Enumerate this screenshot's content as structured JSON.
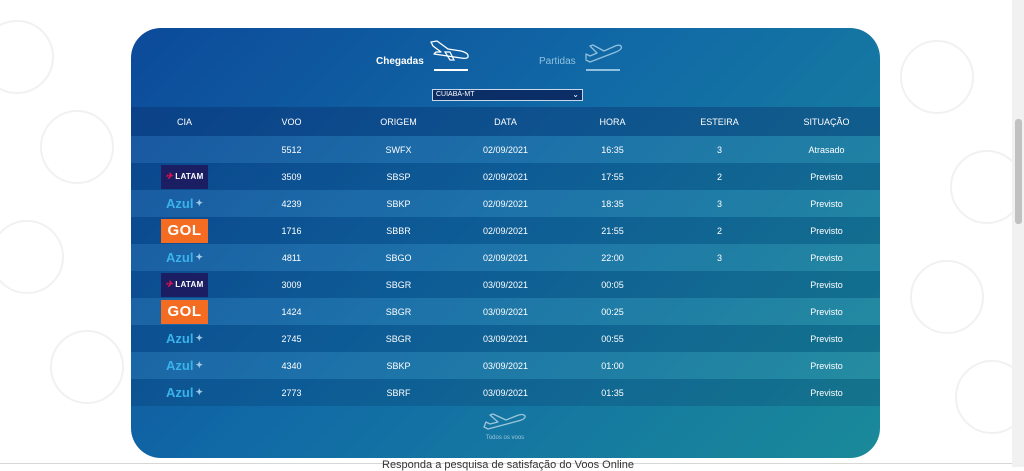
{
  "tabs": {
    "arrivals_label": "Chegadas",
    "departures_label": "Partidas"
  },
  "city_select": {
    "value": "CUIABÁ-MT"
  },
  "table": {
    "headers": [
      "CIA",
      "VOO",
      "ORIGEM",
      "DATA",
      "HORA",
      "ESTEIRA",
      "SITUAÇÃO"
    ],
    "rows": [
      {
        "airline": "",
        "flight": "5512",
        "origin": "SWFX",
        "date": "02/09/2021",
        "time": "16:35",
        "belt": "3",
        "status": "Atrasado"
      },
      {
        "airline": "LATAM",
        "flight": "3509",
        "origin": "SBSP",
        "date": "02/09/2021",
        "time": "17:55",
        "belt": "2",
        "status": "Previsto"
      },
      {
        "airline": "Azul",
        "flight": "4239",
        "origin": "SBKP",
        "date": "02/09/2021",
        "time": "18:35",
        "belt": "3",
        "status": "Previsto"
      },
      {
        "airline": "GOL",
        "flight": "1716",
        "origin": "SBBR",
        "date": "02/09/2021",
        "time": "21:55",
        "belt": "2",
        "status": "Previsto"
      },
      {
        "airline": "Azul",
        "flight": "4811",
        "origin": "SBGO",
        "date": "02/09/2021",
        "time": "22:00",
        "belt": "3",
        "status": "Previsto"
      },
      {
        "airline": "LATAM",
        "flight": "3009",
        "origin": "SBGR",
        "date": "03/09/2021",
        "time": "00:05",
        "belt": "",
        "status": "Previsto"
      },
      {
        "airline": "GOL",
        "flight": "1424",
        "origin": "SBGR",
        "date": "03/09/2021",
        "time": "00:25",
        "belt": "",
        "status": "Previsto"
      },
      {
        "airline": "Azul",
        "flight": "2745",
        "origin": "SBGR",
        "date": "03/09/2021",
        "time": "00:55",
        "belt": "",
        "status": "Previsto"
      },
      {
        "airline": "Azul",
        "flight": "4340",
        "origin": "SBKP",
        "date": "03/09/2021",
        "time": "01:00",
        "belt": "",
        "status": "Previsto"
      },
      {
        "airline": "Azul",
        "flight": "2773",
        "origin": "SBRF",
        "date": "03/09/2021",
        "time": "01:35",
        "belt": "",
        "status": "Previsto"
      }
    ]
  },
  "all_flights_label": "Todos os voos",
  "footer_text": "Responda a pesquisa de satisfação do Voos Online",
  "colors": {
    "latam": "#1b1e63",
    "gol": "#f36c21",
    "azul": "#3ab2ea"
  },
  "icons": {
    "arrivals": "plane-landing-icon",
    "departures": "plane-takeoff-icon",
    "all_flights": "plane-icon",
    "select": "chevron-down-icon"
  }
}
